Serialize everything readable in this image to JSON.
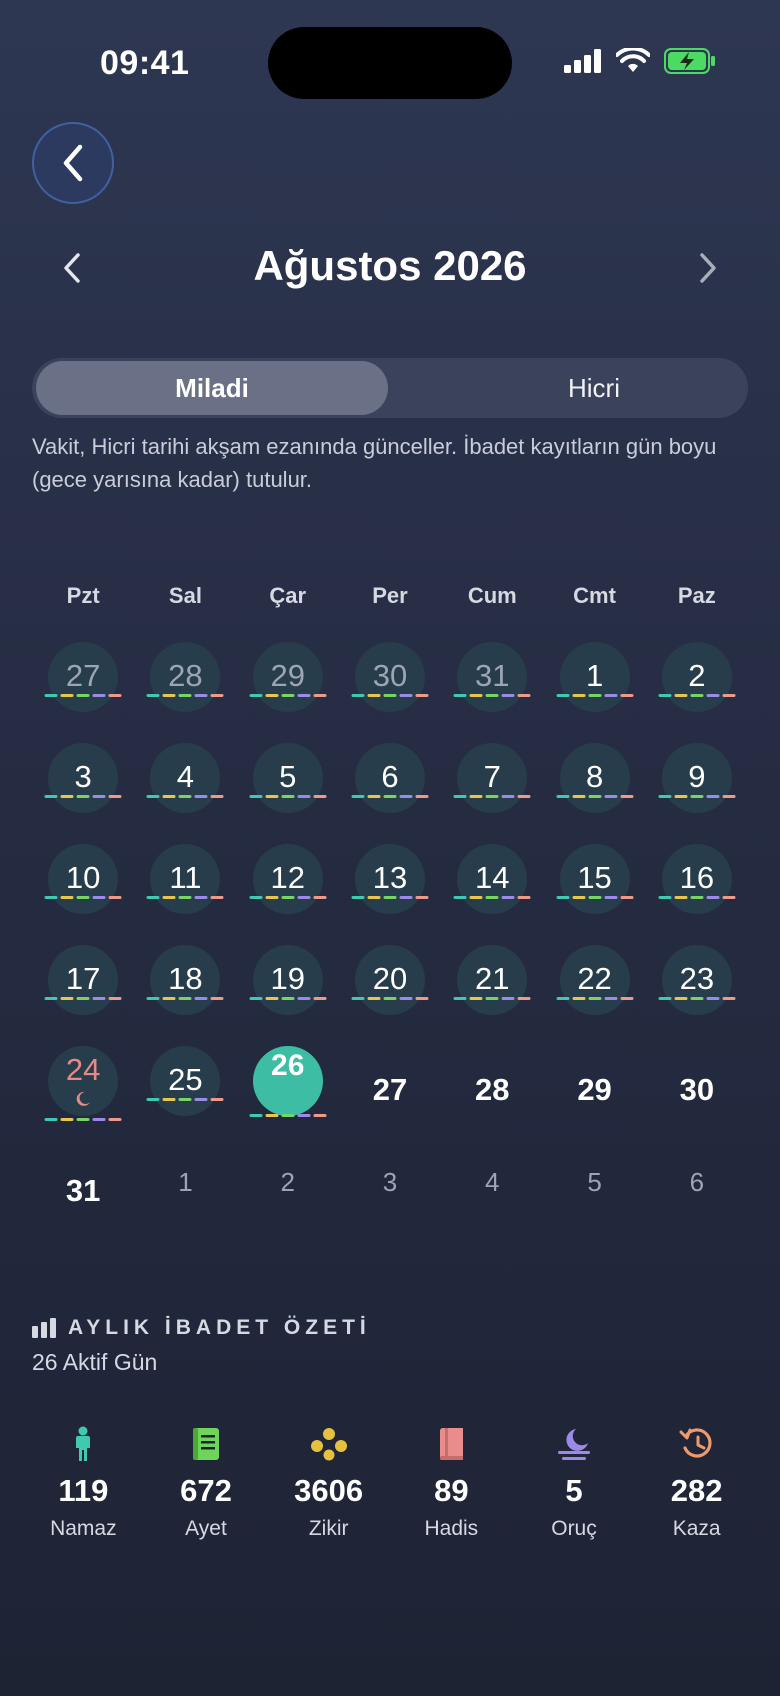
{
  "status": {
    "time": "09:41"
  },
  "month_nav": {
    "title": "Ağustos 2026"
  },
  "segment": {
    "miladi": "Miladi",
    "hicri": "Hicri"
  },
  "info_text": "Vakit, Hicri tarihi akşam ezanında günceller. İbadet kayıtların gün boyu (gece yarısına kadar) tutulur.",
  "weekdays": [
    "Pzt",
    "Sal",
    "Çar",
    "Per",
    "Cum",
    "Cmt",
    "Paz"
  ],
  "days": [
    {
      "n": "27",
      "kind": "prev",
      "bars": [
        1,
        1,
        1,
        1,
        1
      ]
    },
    {
      "n": "28",
      "kind": "prev",
      "bars": [
        1,
        1,
        1,
        1,
        1
      ]
    },
    {
      "n": "29",
      "kind": "prev",
      "bars": [
        1,
        1,
        1,
        1,
        1
      ]
    },
    {
      "n": "30",
      "kind": "prev",
      "bars": [
        1,
        1,
        1,
        1,
        1
      ]
    },
    {
      "n": "31",
      "kind": "prev",
      "bars": [
        1,
        1,
        1,
        1,
        1
      ]
    },
    {
      "n": "1",
      "kind": "cur",
      "bars": [
        1,
        1,
        1,
        1,
        1
      ]
    },
    {
      "n": "2",
      "kind": "cur",
      "bars": [
        1,
        1,
        1,
        1,
        1
      ]
    },
    {
      "n": "3",
      "kind": "cur",
      "bars": [
        1,
        1,
        1,
        1,
        1
      ]
    },
    {
      "n": "4",
      "kind": "cur",
      "bars": [
        1,
        1,
        1,
        1,
        1
      ]
    },
    {
      "n": "5",
      "kind": "cur",
      "bars": [
        1,
        1,
        1,
        1,
        1
      ]
    },
    {
      "n": "6",
      "kind": "cur",
      "bars": [
        1,
        1,
        1,
        1,
        1
      ]
    },
    {
      "n": "7",
      "kind": "cur",
      "bars": [
        1,
        1,
        1,
        1,
        1
      ]
    },
    {
      "n": "8",
      "kind": "cur",
      "bars": [
        1,
        1,
        1,
        1,
        1
      ]
    },
    {
      "n": "9",
      "kind": "cur",
      "bars": [
        1,
        1,
        1,
        1,
        1
      ]
    },
    {
      "n": "10",
      "kind": "cur",
      "bars": [
        1,
        1,
        1,
        1,
        1
      ]
    },
    {
      "n": "11",
      "kind": "cur",
      "bars": [
        1,
        1,
        1,
        1,
        1
      ]
    },
    {
      "n": "12",
      "kind": "cur",
      "bars": [
        1,
        1,
        1,
        1,
        1
      ]
    },
    {
      "n": "13",
      "kind": "cur",
      "bars": [
        1,
        1,
        1,
        1,
        1
      ]
    },
    {
      "n": "14",
      "kind": "cur",
      "bars": [
        1,
        1,
        1,
        1,
        1
      ]
    },
    {
      "n": "15",
      "kind": "cur",
      "bars": [
        1,
        1,
        1,
        1,
        1
      ]
    },
    {
      "n": "16",
      "kind": "cur",
      "bars": [
        1,
        1,
        1,
        1,
        1
      ]
    },
    {
      "n": "17",
      "kind": "cur",
      "bars": [
        1,
        1,
        1,
        1,
        1
      ]
    },
    {
      "n": "18",
      "kind": "cur",
      "bars": [
        1,
        1,
        1,
        1,
        1
      ]
    },
    {
      "n": "19",
      "kind": "cur",
      "bars": [
        1,
        1,
        1,
        1,
        1
      ]
    },
    {
      "n": "20",
      "kind": "cur",
      "bars": [
        1,
        1,
        1,
        1,
        1
      ]
    },
    {
      "n": "21",
      "kind": "cur",
      "bars": [
        1,
        1,
        1,
        1,
        1
      ]
    },
    {
      "n": "22",
      "kind": "cur",
      "bars": [
        1,
        1,
        1,
        1,
        1
      ]
    },
    {
      "n": "23",
      "kind": "cur",
      "bars": [
        1,
        1,
        1,
        1,
        1
      ]
    },
    {
      "n": "24",
      "kind": "special",
      "bars": [
        1,
        1,
        1,
        1,
        1
      ]
    },
    {
      "n": "25",
      "kind": "cur",
      "bars": [
        1,
        1,
        1,
        1,
        1
      ]
    },
    {
      "n": "26",
      "kind": "today",
      "bars": [
        1,
        1,
        1,
        1,
        1
      ]
    },
    {
      "n": "27",
      "kind": "plain",
      "bars": []
    },
    {
      "n": "28",
      "kind": "plain",
      "bars": []
    },
    {
      "n": "29",
      "kind": "plain",
      "bars": []
    },
    {
      "n": "30",
      "kind": "plain",
      "bars": []
    },
    {
      "n": "31",
      "kind": "plain",
      "bars": []
    },
    {
      "n": "1",
      "kind": "next",
      "bars": []
    },
    {
      "n": "2",
      "kind": "next",
      "bars": []
    },
    {
      "n": "3",
      "kind": "next",
      "bars": []
    },
    {
      "n": "4",
      "kind": "next",
      "bars": []
    },
    {
      "n": "5",
      "kind": "next",
      "bars": []
    },
    {
      "n": "6",
      "kind": "next",
      "bars": []
    }
  ],
  "bar_colors": [
    "#3fc9b0",
    "#e6c64b",
    "#7ad461",
    "#9b8be6",
    "#ee9a8a"
  ],
  "summary": {
    "title": "AYLIK İBADET ÖZETİ",
    "subtitle": "26 Aktif Gün",
    "stats": [
      {
        "value": "119",
        "label": "Namaz",
        "icon": "person-icon",
        "color": "#3fc9b0"
      },
      {
        "value": "672",
        "label": "Ayet",
        "icon": "book-open-icon",
        "color": "#6fd45a"
      },
      {
        "value": "3606",
        "label": "Zikir",
        "icon": "beads-icon",
        "color": "#e6c03f"
      },
      {
        "value": "89",
        "label": "Hadis",
        "icon": "book-icon",
        "color": "#e88c8c"
      },
      {
        "value": "5",
        "label": "Oruç",
        "icon": "moon-icon",
        "color": "#9b8be6"
      },
      {
        "value": "282",
        "label": "Kaza",
        "icon": "history-icon",
        "color": "#ee9a6a"
      }
    ]
  }
}
